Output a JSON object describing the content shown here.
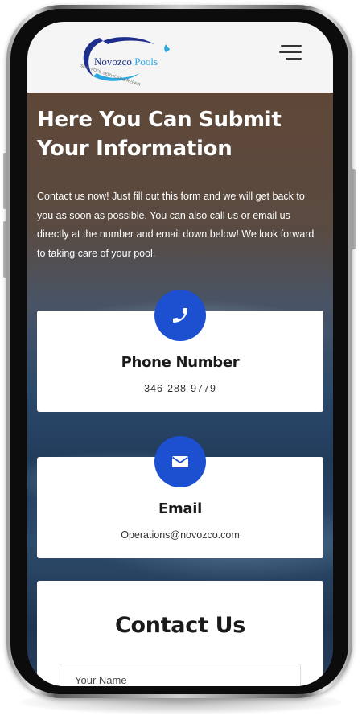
{
  "header": {
    "logo_text": "Novozco",
    "logo_text_accent": "Pools",
    "logo_tagline": "SPA · POOL SERVICES & REPAIR"
  },
  "hero": {
    "title": "Here You Can Submit Your Information",
    "text": "Contact us now! Just fill out this form and we will get back to you as soon as possible. You can also call us or email us directly at the number and email down below! We look forward to taking care of your pool."
  },
  "phone_card": {
    "icon": "phone-icon",
    "title": "Phone Number",
    "value": "346-288-9779"
  },
  "email_card": {
    "icon": "envelope-icon",
    "title": "Email",
    "value": "Operations@novozco.com"
  },
  "contact_form": {
    "title": "Contact Us",
    "name_placeholder": "Your Name"
  },
  "colors": {
    "accent": "#1d4fd1",
    "logo_navy": "#1d2f8a",
    "logo_light_blue": "#2aa7e0",
    "header_bg": "#f5f5f5",
    "hero_top": "#5f4738"
  }
}
